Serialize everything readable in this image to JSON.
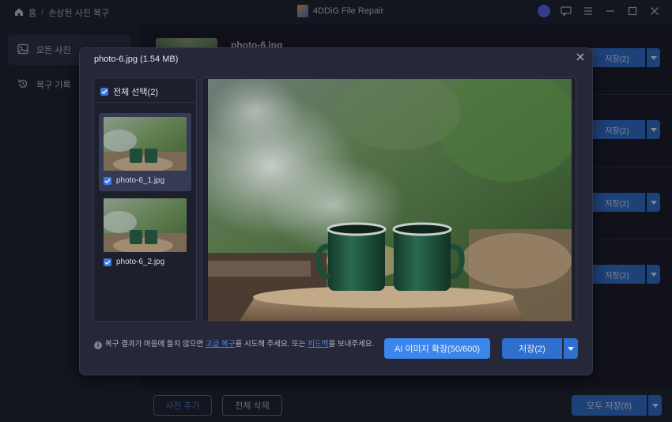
{
  "app": {
    "title": "4DDiG File Repair"
  },
  "breadcrumb": {
    "home": "홈",
    "separator": "/",
    "current": "손상된 사진 복구"
  },
  "sidebar": {
    "items": [
      {
        "label": "모든 사진",
        "icon": "image-icon",
        "active": true
      },
      {
        "label": "복구 기록",
        "icon": "history-icon",
        "active": false
      }
    ]
  },
  "list": {
    "first_item_name": "photo-6.jpg",
    "save_label": "저장(2)",
    "rows": 4
  },
  "bottom": {
    "add_photo": "사진 추가",
    "delete_all": "전체 삭제",
    "save_all": "모두 저장(8)"
  },
  "modal": {
    "title": "photo-6.jpg  (1.54 MB)",
    "select_all": "전체 선택(2)",
    "thumbnails": [
      {
        "name": "photo-6_1.jpg",
        "checked": true,
        "selected": true
      },
      {
        "name": "photo-6_2.jpg",
        "checked": true,
        "selected": false
      }
    ],
    "hint": {
      "part1": "복구 결과가 마음에 들지 않으면 ",
      "link1": "고급 복구",
      "part2": "를 시도해 주세요. 또는 ",
      "link2": "피드백",
      "part3": "을 보내주세요."
    },
    "ai_button": "AI 이미지 확장(50/600)",
    "save_button": "저장(2)"
  },
  "colors": {
    "accent": "#2f6fd0",
    "ai_button": "#3b86ea",
    "background": "#161825",
    "modal": "#262839"
  }
}
